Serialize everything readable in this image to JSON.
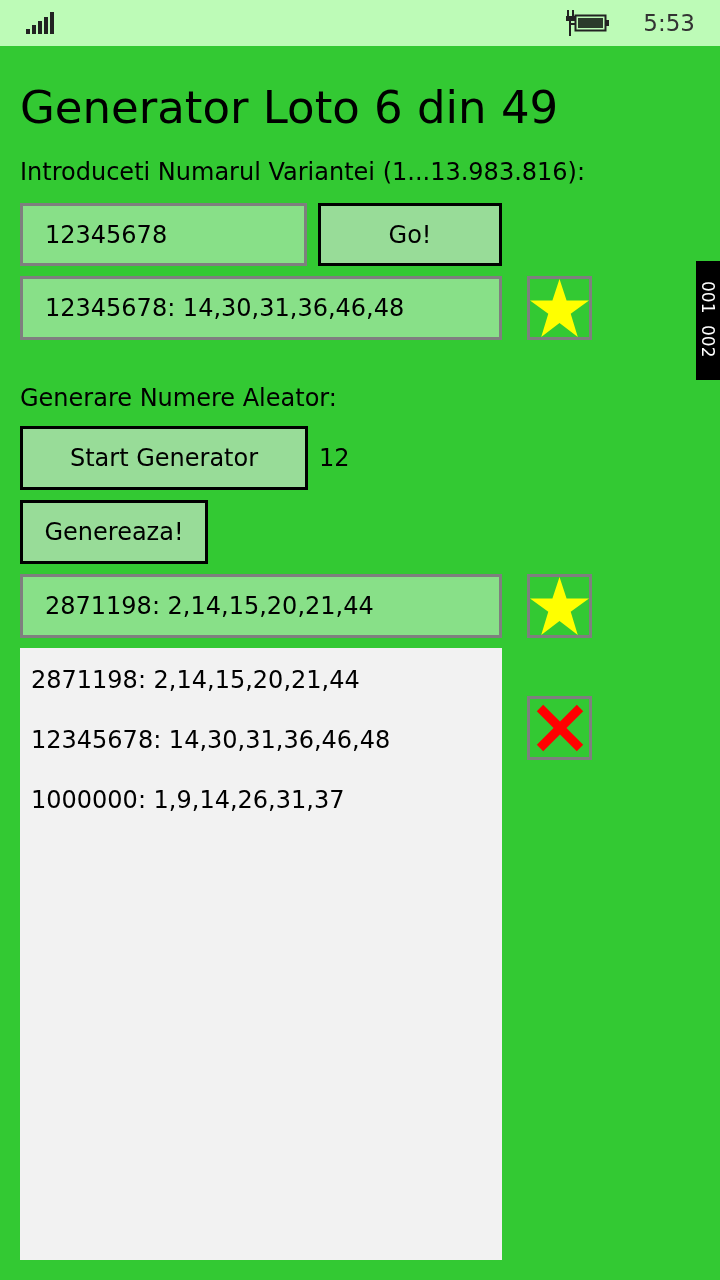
{
  "status_bar": {
    "time": "5:53"
  },
  "title": "Generator Loto 6 din 49",
  "variant_section": {
    "label": "Introduceti Numarul Variantei (1...13.983.816):",
    "number_input": {
      "value": "12345678"
    },
    "go_button": "Go!",
    "result": {
      "value": "12345678: 14,30,31,36,46,48"
    }
  },
  "random_section": {
    "label": "Generare Numere Aleator:",
    "start_button": "Start Generator",
    "counter": "12",
    "generate_button": "Genereaza!",
    "result": {
      "value": "2871198: 2,14,15,20,21,44"
    }
  },
  "history": {
    "items": [
      {
        "text": "2871198: 2,14,15,20,21,44",
        "selected": false
      },
      {
        "text": "12345678: 14,30,31,36,46,48",
        "selected": false
      },
      {
        "text": "1000000: 1,9,14,26,31,37",
        "selected": false
      }
    ]
  },
  "frame_counter": [
    "001",
    "002"
  ]
}
